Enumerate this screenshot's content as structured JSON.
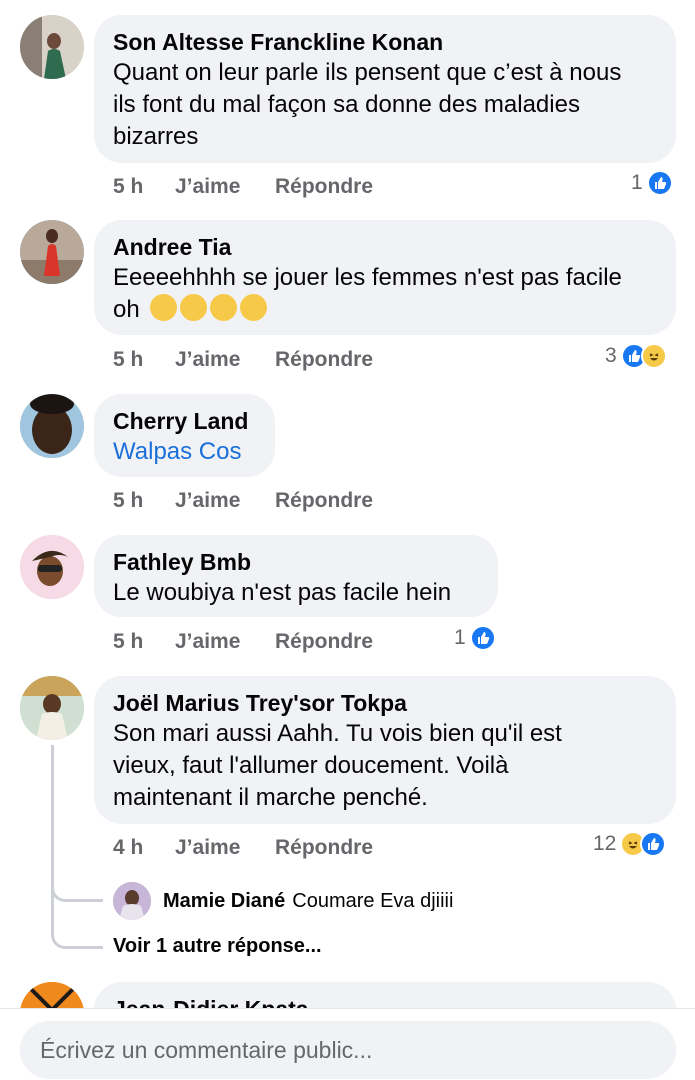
{
  "comments": [
    {
      "author": "Son Altesse Franckline Konan",
      "lines": [
        "Quant on leur parle ils pensent que c’est à nous",
        "ils font du mal façon sa donne des maladies",
        "bizarres"
      ],
      "time": "5 h",
      "like": "J’aime",
      "reply": "Répondre",
      "reaction_count": "1",
      "reactions": [
        "like"
      ]
    },
    {
      "author": "Andree Tia",
      "lines": [
        "Eeeeehhhh se jouer les femmes n'est pas facile",
        "oh"
      ],
      "emoji_count": 4,
      "emoji": "😂",
      "time": "5 h",
      "like": "J’aime",
      "reply": "Répondre",
      "reaction_count": "3",
      "reactions": [
        "like",
        "haha"
      ]
    },
    {
      "author": "Cherry Land",
      "lines": [
        "Walpas Cos"
      ],
      "tagged": true,
      "time": "5 h",
      "like": "J’aime",
      "reply": "Répondre"
    },
    {
      "author": "Fathley Bmb",
      "lines": [
        "Le woubiya n'est pas facile hein"
      ],
      "time": "5 h",
      "like": "J’aime",
      "reply": "Répondre",
      "reaction_count": "1",
      "reactions": [
        "like"
      ]
    },
    {
      "author": "Joël Marius Trey'sor Tokpa",
      "lines": [
        "Son mari aussi Aahh. Tu vois bien qu'il est",
        "vieux, faut l'allumer doucement. Voilà",
        "maintenant il marche penché."
      ],
      "time": "4 h",
      "like": "J’aime",
      "reply": "Répondre",
      "reaction_count": "12",
      "reactions": [
        "haha",
        "like"
      ]
    }
  ],
  "reply_preview": {
    "author": "Mamie Diané",
    "text": "Coumare Eva djiiii"
  },
  "more_replies": "Voir 1 autre réponse...",
  "partial_author": "Jean-Didier Kpata",
  "composer": {
    "placeholder": "Écrivez un commentaire public..."
  },
  "colors": {
    "like": "#1877f2",
    "haha": "#f7c948",
    "bubble": "#f0f2f5",
    "meta": "#65676b",
    "link": "#1b6fd9"
  },
  "icons": {
    "like": "thumbs-up-icon",
    "haha": "laughing-face-icon"
  }
}
